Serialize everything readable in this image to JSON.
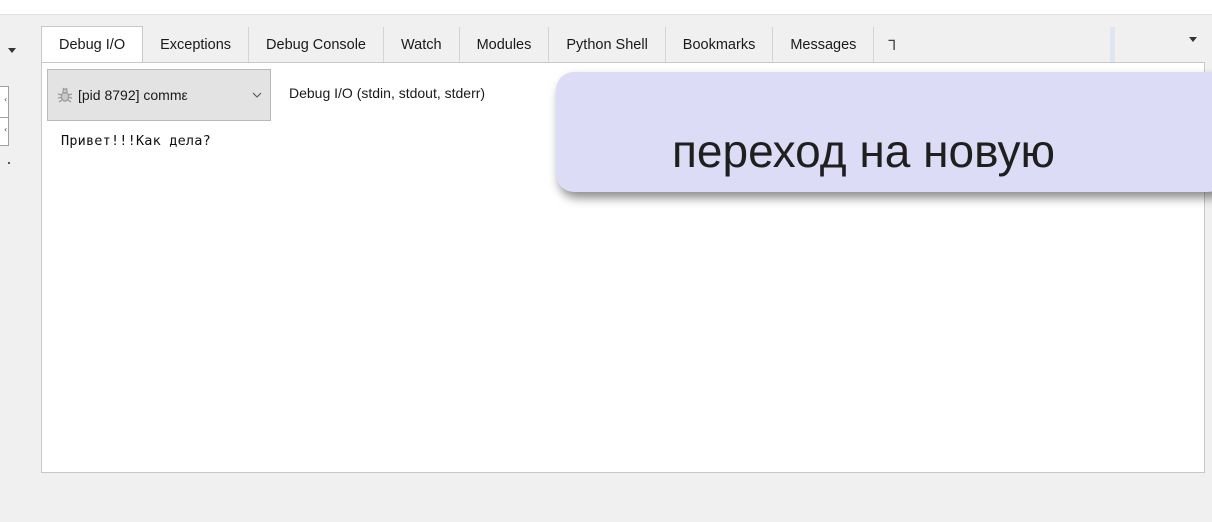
{
  "tabs": [
    {
      "label": "Debug I/O",
      "active": true
    },
    {
      "label": "Exceptions",
      "active": false
    },
    {
      "label": "Debug Console",
      "active": false
    },
    {
      "label": "Watch",
      "active": false
    },
    {
      "label": "Modules",
      "active": false
    },
    {
      "label": "Python Shell",
      "active": false
    },
    {
      "label": "Bookmarks",
      "active": false
    },
    {
      "label": "Messages",
      "active": false
    }
  ],
  "tab_overflow_glyph": "Ꞁ",
  "process_selector": {
    "label": "[pid 8792] commε",
    "icon": "bug-icon"
  },
  "io_stream_label": "Debug I/O (stdin, stdout, stderr)",
  "output": "Привет!!!Как дела?",
  "callout": {
    "text": "переход на новую",
    "background": "#dcdcf6"
  },
  "colors": {
    "active_tab_bg": "#ffffff",
    "panel_bg": "#f0f0f0",
    "select_bg": "#e3e3e3"
  }
}
